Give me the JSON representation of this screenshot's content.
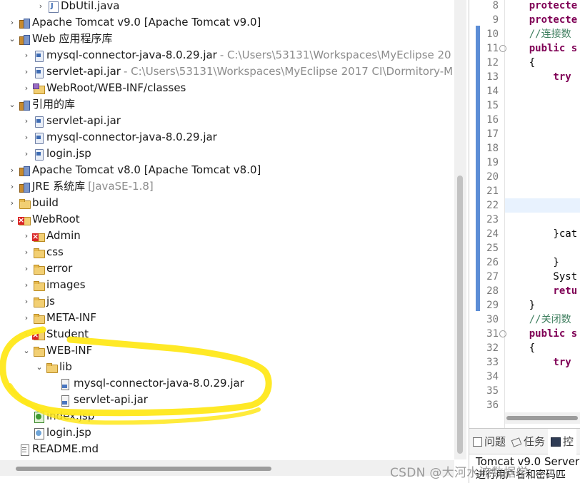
{
  "explorer": {
    "rows": [
      {
        "label": "DbUtil.java",
        "detail": "",
        "twisty": "›",
        "icon": "java-file-icon"
      },
      {
        "label": "Apache Tomcat v9.0 [Apache Tomcat v9.0]",
        "detail": "",
        "twisty": "›",
        "icon": "library-icon"
      },
      {
        "label": "Web 应用程序库",
        "detail": "",
        "twisty": "⌄",
        "icon": "library-icon"
      },
      {
        "label": "mysql-connector-java-8.0.29.jar",
        "detail": "- C:\\Users\\53131\\Workspaces\\MyEclipse 20",
        "twisty": "›",
        "icon": "jar-icon"
      },
      {
        "label": "servlet-api.jar",
        "detail": "- C:\\Users\\53131\\Workspaces\\MyEclipse 2017 CI\\Dormitory-M",
        "twisty": "›",
        "icon": "jar-icon"
      },
      {
        "label": "WebRoot/WEB-INF/classes",
        "detail": "",
        "twisty": "›",
        "icon": "class-folder-icon"
      },
      {
        "label": "引用的库",
        "detail": "",
        "twisty": "⌄",
        "icon": "library-icon"
      },
      {
        "label": "servlet-api.jar",
        "detail": "",
        "twisty": "›",
        "icon": "jar-icon"
      },
      {
        "label": "mysql-connector-java-8.0.29.jar",
        "detail": "",
        "twisty": "›",
        "icon": "jar-icon"
      },
      {
        "label": "login.jsp",
        "detail": "",
        "twisty": "›",
        "icon": "jar-icon"
      },
      {
        "label": "Apache Tomcat v8.0 [Apache Tomcat v8.0]",
        "detail": "",
        "twisty": "›",
        "icon": "library-icon"
      },
      {
        "label": "JRE 系统库",
        "detail": "[JavaSE-1.8]",
        "twisty": "›",
        "icon": "library-icon"
      },
      {
        "label": "build",
        "detail": "",
        "twisty": "›",
        "icon": "folder-icon"
      },
      {
        "label": "WebRoot",
        "detail": "",
        "twisty": "⌄",
        "icon": "folder-error-icon"
      },
      {
        "label": "Admin",
        "detail": "",
        "twisty": "›",
        "icon": "folder-error-icon"
      },
      {
        "label": "css",
        "detail": "",
        "twisty": "›",
        "icon": "folder-icon"
      },
      {
        "label": "error",
        "detail": "",
        "twisty": "›",
        "icon": "folder-icon"
      },
      {
        "label": "images",
        "detail": "",
        "twisty": "›",
        "icon": "folder-icon"
      },
      {
        "label": "js",
        "detail": "",
        "twisty": "›",
        "icon": "folder-icon"
      },
      {
        "label": "META-INF",
        "detail": "",
        "twisty": "›",
        "icon": "folder-icon"
      },
      {
        "label": "Student",
        "detail": "",
        "twisty": "›",
        "icon": "folder-error-icon"
      },
      {
        "label": "WEB-INF",
        "detail": "",
        "twisty": "⌄",
        "icon": "folder-icon"
      },
      {
        "label": "lib",
        "detail": "",
        "twisty": "⌄",
        "icon": "folder-icon"
      },
      {
        "label": "mysql-connector-java-8.0.29.jar",
        "detail": "",
        "twisty": "",
        "icon": "jar-reference-icon"
      },
      {
        "label": "servlet-api.jar",
        "detail": "",
        "twisty": "",
        "icon": "jar-reference-icon"
      },
      {
        "label": "index.jsp",
        "detail": "",
        "twisty": "",
        "icon": "jsp-file-icon"
      },
      {
        "label": "login.jsp",
        "detail": "",
        "twisty": "",
        "icon": "jsp-file-icon"
      },
      {
        "label": "README.md",
        "detail": "",
        "twisty": "",
        "icon": "text-file-icon"
      }
    ]
  },
  "editor": {
    "lines": [
      {
        "no": "8",
        "text": "    protecte",
        "kind": "kw"
      },
      {
        "no": "9",
        "text": "    protecte",
        "kind": "kw"
      },
      {
        "no": "10",
        "text": "    //连接数",
        "kind": "cm"
      },
      {
        "no": "11",
        "text": "    public s",
        "kind": "kw",
        "fold": "⊖"
      },
      {
        "no": "12",
        "text": "    {",
        "kind": "plain"
      },
      {
        "no": "13",
        "text": "        try",
        "kind": "kw"
      },
      {
        "no": "14",
        "text": "",
        "kind": "plain"
      },
      {
        "no": "15",
        "text": "",
        "kind": "plain"
      },
      {
        "no": "16",
        "text": "",
        "kind": "plain"
      },
      {
        "no": "17",
        "text": "",
        "kind": "plain"
      },
      {
        "no": "18",
        "text": "",
        "kind": "plain"
      },
      {
        "no": "19",
        "text": "",
        "kind": "plain"
      },
      {
        "no": "20",
        "text": "",
        "kind": "plain"
      },
      {
        "no": "21",
        "text": "",
        "kind": "plain"
      },
      {
        "no": "22",
        "text": "",
        "kind": "plain"
      },
      {
        "no": "23",
        "text": "",
        "kind": "plain"
      },
      {
        "no": "24",
        "text": "        }cat",
        "kind": "plain"
      },
      {
        "no": "25",
        "text": "",
        "kind": "plain"
      },
      {
        "no": "26",
        "text": "        }",
        "kind": "plain"
      },
      {
        "no": "27",
        "text": "        Syst",
        "kind": "plain"
      },
      {
        "no": "28",
        "text": "        retu",
        "kind": "kw"
      },
      {
        "no": "29",
        "text": "    }",
        "kind": "plain"
      },
      {
        "no": "30",
        "text": "    //关闭数",
        "kind": "cm"
      },
      {
        "no": "31",
        "text": "    public s",
        "kind": "kw",
        "fold": "⊖"
      },
      {
        "no": "32",
        "text": "    {",
        "kind": "plain"
      },
      {
        "no": "33",
        "text": "        try",
        "kind": "kw"
      },
      {
        "no": "34",
        "text": "",
        "kind": "plain"
      },
      {
        "no": "35",
        "text": "",
        "kind": "plain"
      },
      {
        "no": "36",
        "text": "",
        "kind": "plain"
      }
    ]
  },
  "console": {
    "tabs": [
      {
        "label": "问题",
        "icon": "problems-icon"
      },
      {
        "label": "任务",
        "icon": "tasks-icon"
      },
      {
        "label": "控",
        "icon": "console-icon"
      }
    ],
    "title": "Tomcat v9.0 Server",
    "output": "进行用户名和密码匹"
  },
  "watermark": "CSDN @大河水流数据学",
  "colors": {
    "keyword": "#7f0055",
    "comment": "#3f7f5f",
    "detail_text": "#8c8c8c",
    "marker": "#ffe81a"
  }
}
